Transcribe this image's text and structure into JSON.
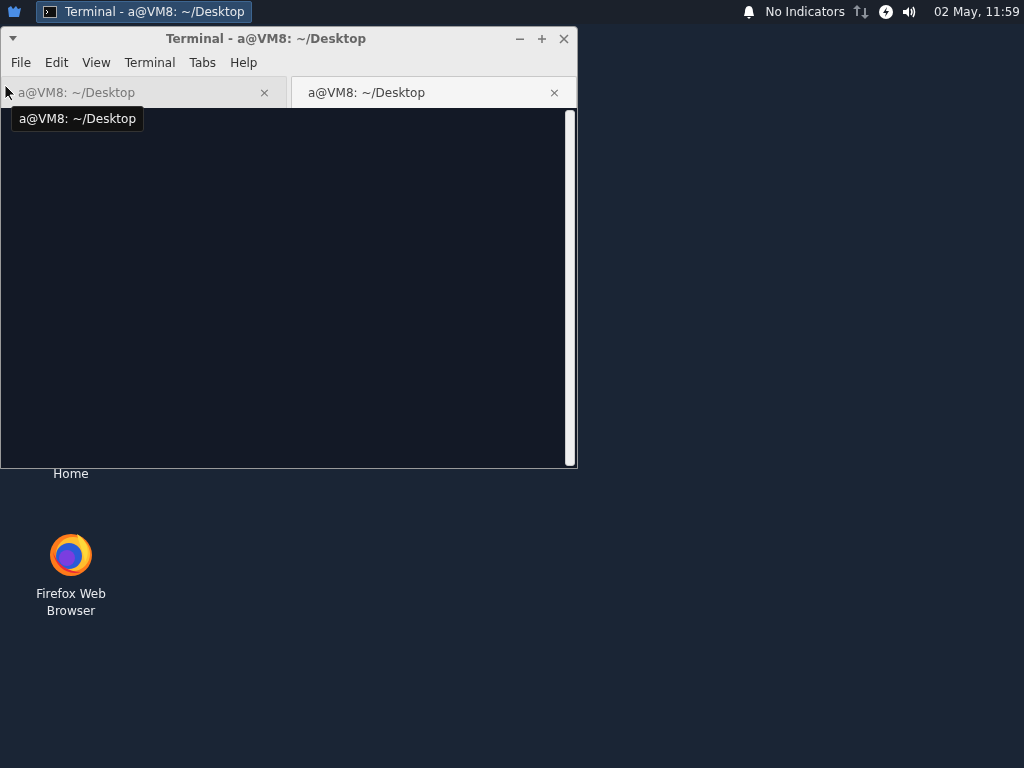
{
  "panel": {
    "taskbar_button": {
      "label": "Terminal - a@VM8: ~/Desktop",
      "selected": true
    },
    "indicator_text": "No Indicators",
    "clock": "02 May, 11:59"
  },
  "window": {
    "title": "Terminal - a@VM8: ~/Desktop",
    "menu": [
      "File",
      "Edit",
      "View",
      "Terminal",
      "Tabs",
      "Help"
    ],
    "tabs": [
      {
        "label": "a@VM8: ~/Desktop",
        "close": "×",
        "selected": false
      },
      {
        "label": "a@VM8: ~/Desktop",
        "close": "×",
        "selected": true
      }
    ],
    "tooltip": "a@VM8: ~/Desktop"
  },
  "desktop_icons": [
    {
      "kind": "home",
      "label": "Home"
    },
    {
      "kind": "browser",
      "label": "Firefox Web Browser"
    }
  ]
}
